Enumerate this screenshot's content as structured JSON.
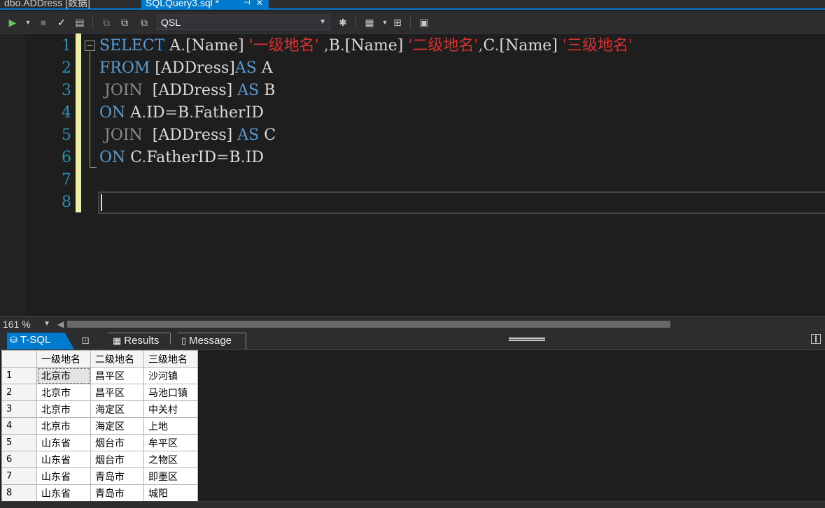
{
  "doc_tabs": [
    {
      "label": "dbo.ADDress [数据]",
      "active": false
    },
    {
      "label": "SQLQuery3.sql *",
      "active": true
    }
  ],
  "toolbar": {
    "database": "QSL"
  },
  "editor": {
    "line_numbers": [
      "1",
      "2",
      "3",
      "4",
      "5",
      "6",
      "7",
      "8"
    ],
    "lines": [
      [
        {
          "t": "SELECT",
          "c": "kw"
        },
        {
          "t": " A",
          "c": ""
        },
        {
          "t": ".",
          "c": "op"
        },
        {
          "t": "[Name]",
          "c": ""
        },
        {
          "t": " ",
          "c": ""
        },
        {
          "t": "'一级地名'",
          "c": "str"
        },
        {
          "t": " ",
          "c": ""
        },
        {
          "t": ",",
          "c": "op"
        },
        {
          "t": "B",
          "c": ""
        },
        {
          "t": ".",
          "c": "op"
        },
        {
          "t": "[Name]",
          "c": ""
        },
        {
          "t": " ",
          "c": ""
        },
        {
          "t": "'二级地名'",
          "c": "str"
        },
        {
          "t": ",",
          "c": "op"
        },
        {
          "t": "C",
          "c": ""
        },
        {
          "t": ".",
          "c": "op"
        },
        {
          "t": "[Name]",
          "c": ""
        },
        {
          "t": " ",
          "c": ""
        },
        {
          "t": "'三级地名'",
          "c": "str"
        }
      ],
      [
        {
          "t": "FROM",
          "c": "kw"
        },
        {
          "t": " [ADDress]",
          "c": ""
        },
        {
          "t": "AS",
          "c": "kw"
        },
        {
          "t": " A",
          "c": ""
        }
      ],
      [
        {
          "t": " JOIN",
          "c": "gray"
        },
        {
          "t": "  [ADDress] ",
          "c": ""
        },
        {
          "t": "AS",
          "c": "kw"
        },
        {
          "t": " B",
          "c": ""
        }
      ],
      [
        {
          "t": "ON",
          "c": "kw"
        },
        {
          "t": " A",
          "c": ""
        },
        {
          "t": ".",
          "c": "op"
        },
        {
          "t": "ID",
          "c": ""
        },
        {
          "t": "=",
          "c": "op"
        },
        {
          "t": "B",
          "c": ""
        },
        {
          "t": ".",
          "c": "op"
        },
        {
          "t": "FatherID",
          "c": ""
        }
      ],
      [
        {
          "t": " JOIN",
          "c": "gray"
        },
        {
          "t": "  [ADDress] ",
          "c": ""
        },
        {
          "t": "AS",
          "c": "kw"
        },
        {
          "t": " C",
          "c": ""
        }
      ],
      [
        {
          "t": "ON",
          "c": "kw"
        },
        {
          "t": " C",
          "c": ""
        },
        {
          "t": ".",
          "c": "op"
        },
        {
          "t": "FatherID",
          "c": ""
        },
        {
          "t": "=",
          "c": "op"
        },
        {
          "t": "B",
          "c": ""
        },
        {
          "t": ".",
          "c": "op"
        },
        {
          "t": "ID",
          "c": ""
        }
      ],
      [],
      []
    ]
  },
  "zoom": "161 %",
  "result_tabs": {
    "tsql": "T-SQL",
    "results": "Results",
    "message": "Message"
  },
  "grid": {
    "columns": [
      "一级地名",
      "二级地名",
      "三级地名"
    ],
    "rows": [
      [
        "1",
        "北京市",
        "昌平区",
        "沙河镇"
      ],
      [
        "2",
        "北京市",
        "昌平区",
        "马池口镇"
      ],
      [
        "3",
        "北京市",
        "海定区",
        "中关村"
      ],
      [
        "4",
        "北京市",
        "海定区",
        "上地"
      ],
      [
        "5",
        "山东省",
        "烟台市",
        "牟平区"
      ],
      [
        "6",
        "山东省",
        "烟台市",
        "之物区"
      ],
      [
        "7",
        "山东省",
        "青岛市",
        "即墨区"
      ],
      [
        "8",
        "山东省",
        "青岛市",
        "城阳"
      ]
    ]
  },
  "colors": {
    "accent": "#007acc",
    "keyword": "#569cd6",
    "string": "#d93030",
    "line_number": "#2b91af",
    "change_marker": "#eff0a5"
  }
}
